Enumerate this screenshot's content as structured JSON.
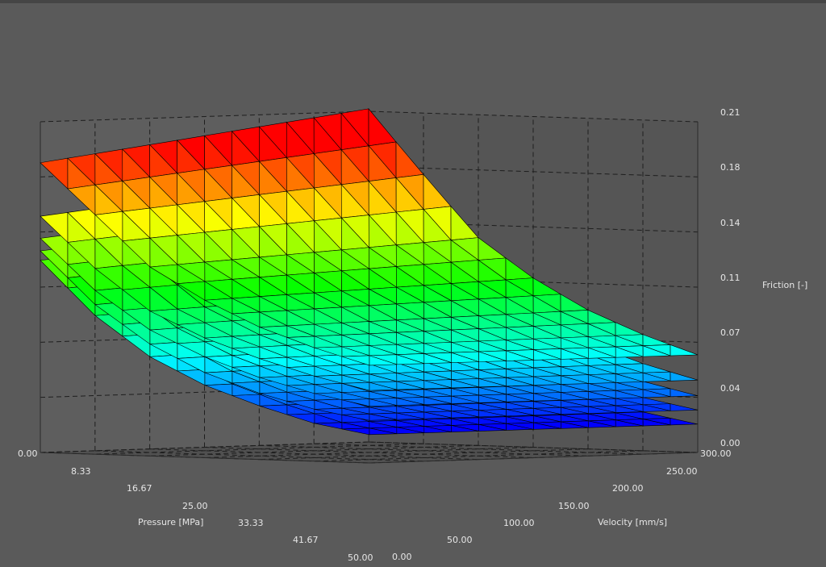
{
  "chart_data": {
    "type": "surface3d",
    "title": "",
    "axes": {
      "pressure": {
        "label": "Pressure [MPa]",
        "range": [
          0,
          50
        ],
        "ticks": [
          "0.00",
          "8.33",
          "16.67",
          "25.00",
          "33.33",
          "41.67",
          "50.00"
        ]
      },
      "velocity": {
        "label": "Velocity [mm/s]",
        "range": [
          0,
          300
        ],
        "ticks": [
          "0.00",
          "50.00",
          "100.00",
          "150.00",
          "200.00",
          "250.00",
          "300.00"
        ]
      },
      "friction": {
        "label": "Friction [-]",
        "range": [
          0,
          0.21
        ],
        "ticks": [
          "0.00",
          "0.04",
          "0.07",
          "0.11",
          "0.14",
          "0.18",
          "0.21"
        ]
      }
    },
    "colormap": [
      "#0000ff",
      "#00ffff",
      "#00ff00",
      "#ffff00",
      "#ff0000"
    ],
    "grid": true,
    "surfaces": [
      {
        "pressure": 0.0,
        "friction_at_velocity": [
          0.184,
          0.152,
          0.12,
          0.1,
          0.084,
          0.072,
          0.062
        ]
      },
      {
        "pressure": 8.33,
        "friction_at_velocity": [
          0.15,
          0.118,
          0.092,
          0.076,
          0.064,
          0.054,
          0.046
        ]
      },
      {
        "pressure": 16.67,
        "friction_at_velocity": [
          0.136,
          0.104,
          0.08,
          0.064,
          0.052,
          0.043,
          0.036
        ]
      },
      {
        "pressure": 25.0,
        "friction_at_velocity": [
          0.128,
          0.095,
          0.071,
          0.054,
          0.042,
          0.033,
          0.027
        ]
      },
      {
        "pressure": 33.33,
        "friction_at_velocity": [
          0.122,
          0.088,
          0.063,
          0.046,
          0.034,
          0.024,
          0.018
        ]
      }
    ]
  },
  "colors": {
    "background": "#5a5a5a",
    "panel_back": "#555555",
    "panel_side": "#5e5e5e",
    "floor": "#505050",
    "grid_line": "#1e1e1e",
    "mesh_line": "#000000"
  }
}
